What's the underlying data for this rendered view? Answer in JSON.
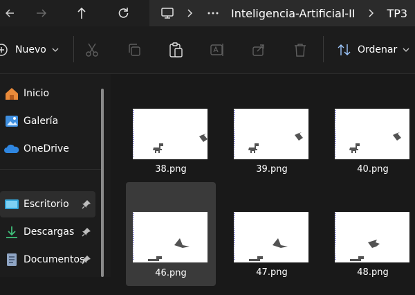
{
  "nav": {
    "back_icon": "arrow-left-icon",
    "forward_icon": "arrow-right-icon",
    "up_icon": "arrow-up-icon",
    "refresh_icon": "refresh-icon"
  },
  "breadcrumb": {
    "items": [
      "Inteligencia-Artificial-II",
      "TP3"
    ]
  },
  "toolbar": {
    "new_label": "Nuevo",
    "sort_label": "Ordenar"
  },
  "sidebar": {
    "items": [
      {
        "label": "Inicio",
        "icon": "home-icon"
      },
      {
        "label": "Galería",
        "icon": "gallery-icon"
      },
      {
        "label": "OneDrive",
        "icon": "cloud-icon"
      },
      {
        "label": "Escritorio",
        "icon": "desktop-icon",
        "pinned": true,
        "selected": true
      },
      {
        "label": "Descargas",
        "icon": "download-icon",
        "pinned": true
      },
      {
        "label": "Documentos",
        "icon": "document-icon",
        "pinned": true
      }
    ]
  },
  "files": [
    {
      "name": "38.png"
    },
    {
      "name": "39.png"
    },
    {
      "name": "40.png"
    },
    {
      "name": "46.png",
      "selected": true
    },
    {
      "name": "47.png"
    },
    {
      "name": "48.png"
    }
  ],
  "colors": {
    "accent": "#4da3ff",
    "selection": "#3a3a3a",
    "background": "#191919"
  }
}
